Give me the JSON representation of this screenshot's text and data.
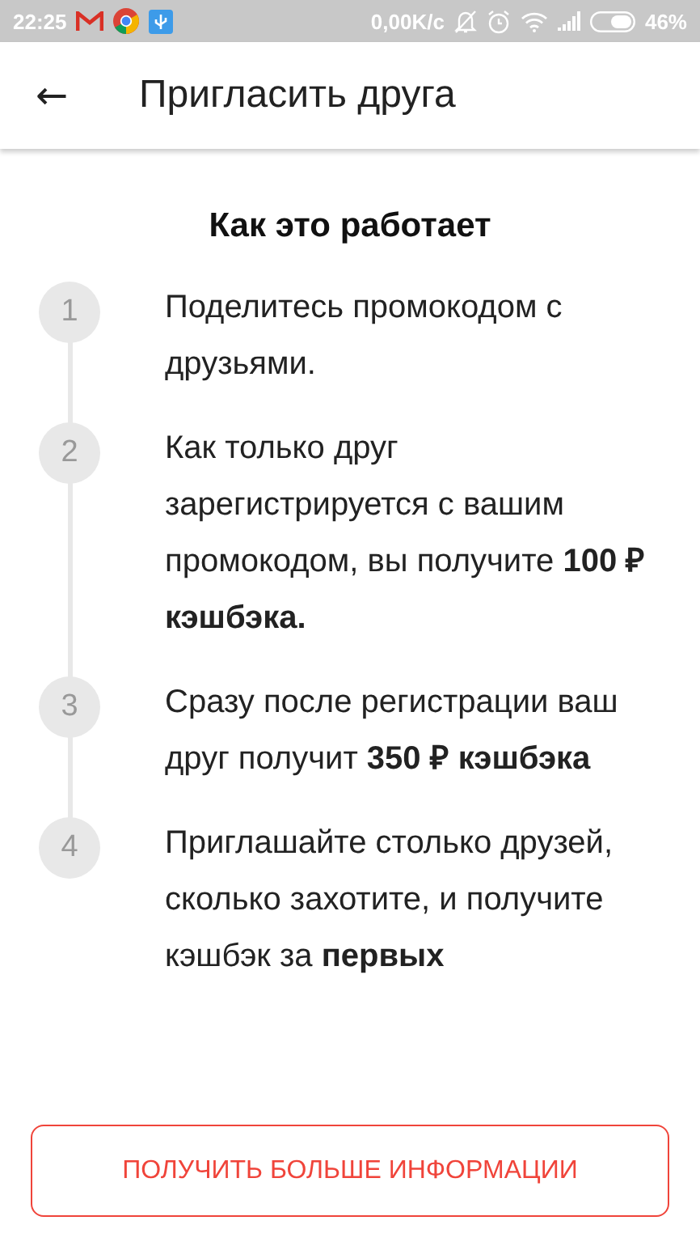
{
  "status_bar": {
    "time": "22:25",
    "speed": "0,00K/с",
    "battery": "46%"
  },
  "app_bar": {
    "back": "←",
    "title": "Пригласить друга"
  },
  "heading": "Как это работает",
  "steps": [
    {
      "number": "1",
      "text": "Поделитесь промокодом с друзьями."
    },
    {
      "number": "2",
      "text": "Как только друг зарегистрируется с вашим промокодом, вы получите **100 ₽ кэшбэка.**"
    },
    {
      "number": "3",
      "text": "Сразу после регистрации ваш друг получит **350 ₽ кэшбэка**"
    },
    {
      "number": "4",
      "text": "Приглашайте столько друзей, сколько захотите, и получите кэшбэк за **первых**"
    }
  ],
  "button": "ПОЛУЧИТЬ БОЛЬШЕ ИНФОРМАЦИИ"
}
